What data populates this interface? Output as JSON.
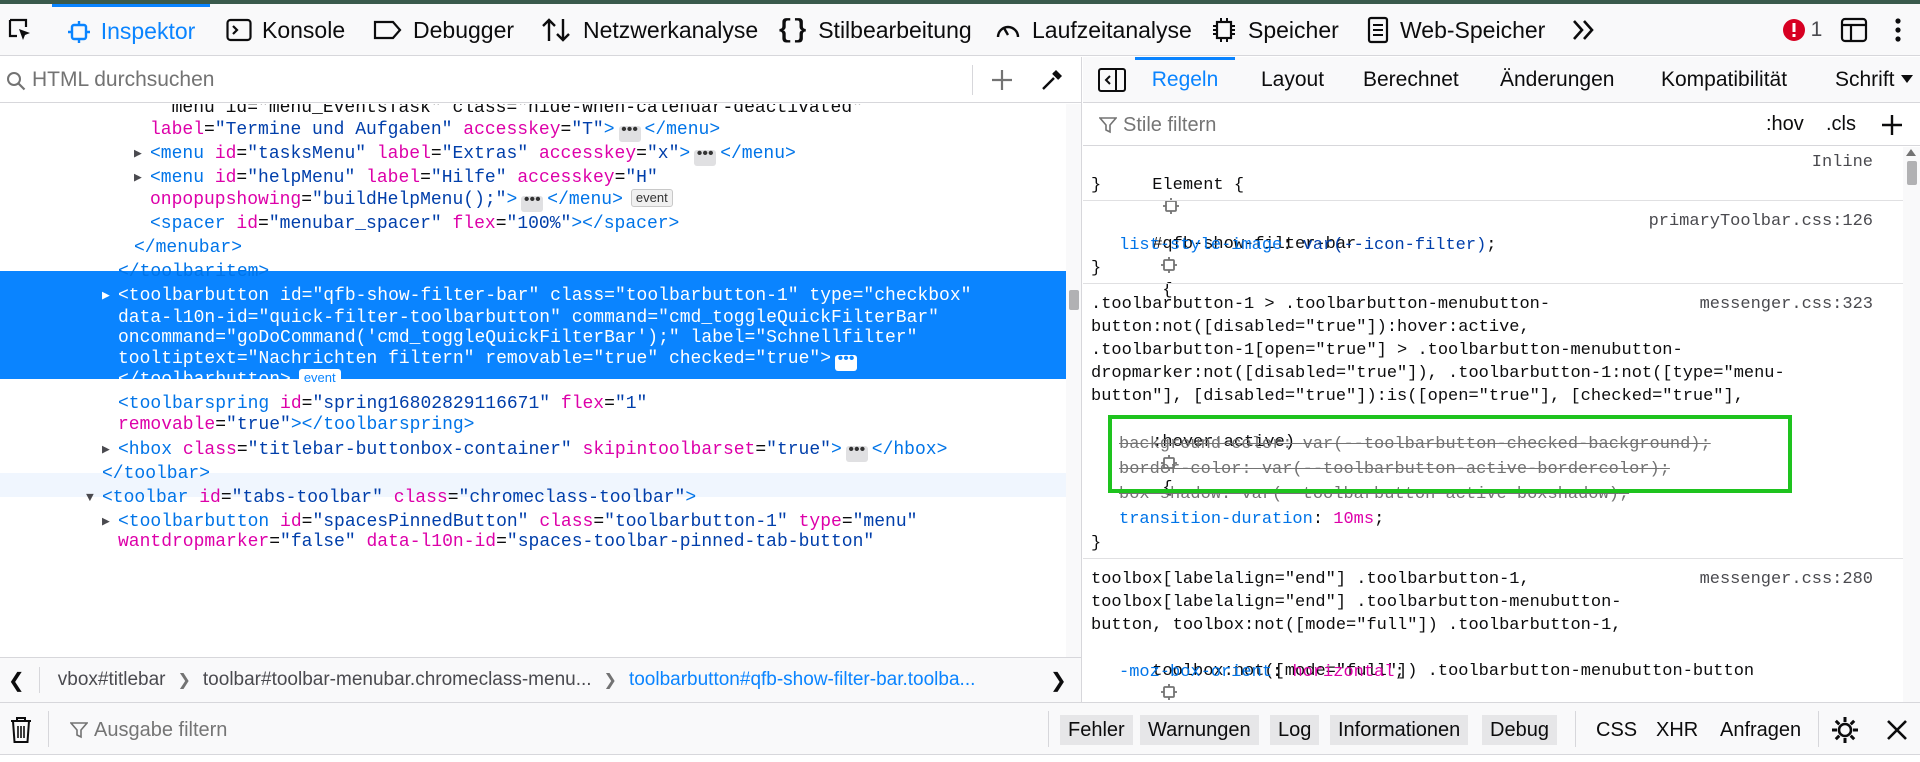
{
  "toolbar": {
    "tabs": [
      {
        "label": "Inspektor",
        "icon": "inspector-icon",
        "active": true
      },
      {
        "label": "Konsole",
        "icon": "console-icon"
      },
      {
        "label": "Debugger",
        "icon": "debugger-icon"
      },
      {
        "label": "Netzwerkanalyse",
        "icon": "network-icon"
      },
      {
        "label": "Stilbearbeitung",
        "icon": "style-editor-icon"
      },
      {
        "label": "Laufzeitanalyse",
        "icon": "performance-icon"
      },
      {
        "label": "Speicher",
        "icon": "memory-icon"
      },
      {
        "label": "Web-Speicher",
        "icon": "storage-icon"
      }
    ],
    "error_count": "1",
    "accent": "#0a84ff",
    "error_color": "#d70022"
  },
  "markup_search": {
    "placeholder": "HTML durchsuchen"
  },
  "markup": {
    "lines": [
      {
        "t": [
          [
            "tx",
            "  menu id=\"menu_EventsTask\" class=\"hide-when-calendar-deactivated\""
          ]
        ]
      },
      {
        "t": [
          [
            "an",
            "label"
          ],
          [
            "tx",
            "="
          ],
          [
            "av",
            "\"Termine und Aufgaben\""
          ],
          [
            "tx",
            " "
          ],
          [
            "an",
            "accesskey"
          ],
          [
            "tx",
            "="
          ],
          [
            "av",
            "\"T\""
          ],
          [
            "tag",
            ">"
          ],
          [
            "ell",
            "•••"
          ],
          [
            "tag",
            "</menu>"
          ]
        ]
      },
      {
        "t": [
          [
            "tag",
            "<menu "
          ],
          [
            "an",
            "id"
          ],
          [
            "tx",
            "="
          ],
          [
            "av",
            "\"tasksMenu\""
          ],
          [
            "tx",
            " "
          ],
          [
            "an",
            "label"
          ],
          [
            "tx",
            "="
          ],
          [
            "av",
            "\"Extras\""
          ],
          [
            "tx",
            " "
          ],
          [
            "an",
            "accesskey"
          ],
          [
            "tx",
            "="
          ],
          [
            "av",
            "\"x\""
          ],
          [
            "tag",
            ">"
          ],
          [
            "ell",
            "•••"
          ],
          [
            "tag",
            "</menu>"
          ]
        ]
      },
      {
        "t": [
          [
            "tag",
            "<menu "
          ],
          [
            "an",
            "id"
          ],
          [
            "tx",
            "="
          ],
          [
            "av",
            "\"helpMenu\""
          ],
          [
            "tx",
            " "
          ],
          [
            "an",
            "label"
          ],
          [
            "tx",
            "="
          ],
          [
            "av",
            "\"Hilfe\""
          ],
          [
            "tx",
            " "
          ],
          [
            "an",
            "accesskey"
          ],
          [
            "tx",
            "="
          ],
          [
            "av",
            "\"H\""
          ]
        ]
      },
      {
        "t": [
          [
            "an",
            "onpopupshowing"
          ],
          [
            "tx",
            "="
          ],
          [
            "av",
            "\"buildHelpMenu();\""
          ],
          [
            "tag",
            ">"
          ],
          [
            "ell",
            "•••"
          ],
          [
            "tag",
            "</menu>"
          ],
          [
            "badge",
            "event"
          ]
        ]
      },
      {
        "t": [
          [
            "tag",
            "<spacer "
          ],
          [
            "an",
            "id"
          ],
          [
            "tx",
            "="
          ],
          [
            "av",
            "\"menubar_spacer\""
          ],
          [
            "tx",
            " "
          ],
          [
            "an",
            "flex"
          ],
          [
            "tx",
            "="
          ],
          [
            "av",
            "\"100%\""
          ],
          [
            "tag",
            "></spacer>"
          ]
        ]
      },
      {
        "t": [
          [
            "tag",
            "</menubar>"
          ]
        ]
      },
      {
        "t": [
          [
            "tag",
            "</toolbaritem>"
          ]
        ]
      },
      {
        "t": [
          [
            "tag",
            "<toolbarbutton "
          ],
          [
            "an",
            "id"
          ],
          [
            "tx",
            "="
          ],
          [
            "av",
            "\"qfb-show-filter-bar\""
          ],
          [
            "tx",
            " "
          ],
          [
            "an",
            "class"
          ],
          [
            "tx",
            "="
          ],
          [
            "av",
            "\"toolbarbutton-1\""
          ],
          [
            "tx",
            " "
          ],
          [
            "an",
            "type"
          ],
          [
            "tx",
            "="
          ],
          [
            "av",
            "\"checkbox\""
          ]
        ]
      },
      {
        "t": [
          [
            "an",
            "data-l10n-id"
          ],
          [
            "tx",
            "="
          ],
          [
            "av",
            "\"quick-filter-toolbarbutton\""
          ],
          [
            "tx",
            " "
          ],
          [
            "an",
            "command"
          ],
          [
            "tx",
            "="
          ],
          [
            "av",
            "\"cmd_toggleQuickFilterBar\""
          ]
        ]
      },
      {
        "t": [
          [
            "an",
            "oncommand"
          ],
          [
            "tx",
            "="
          ],
          [
            "av",
            "\"goDoCommand('cmd_toggleQuickFilterBar');\""
          ],
          [
            "tx",
            " "
          ],
          [
            "an",
            "label"
          ],
          [
            "tx",
            "="
          ],
          [
            "av",
            "\"Schnellfilter\""
          ]
        ]
      },
      {
        "t": [
          [
            "an",
            "tooltiptext"
          ],
          [
            "tx",
            "="
          ],
          [
            "av",
            "\"Nachrichten filtern\""
          ],
          [
            "tx",
            " "
          ],
          [
            "an",
            "removable"
          ],
          [
            "tx",
            "="
          ],
          [
            "av",
            "\"true\""
          ],
          [
            "tx",
            " "
          ],
          [
            "an",
            "checked"
          ],
          [
            "tx",
            "="
          ],
          [
            "av",
            "\"true\""
          ],
          [
            "tag",
            ">"
          ],
          [
            "ell",
            "•••"
          ]
        ]
      },
      {
        "t": [
          [
            "tag",
            "</toolbarbutton>"
          ],
          [
            "badge",
            "event"
          ]
        ]
      },
      {
        "t": [
          [
            "tag",
            "<toolbarspring "
          ],
          [
            "an",
            "id"
          ],
          [
            "tx",
            "="
          ],
          [
            "av",
            "\"spring16802829116671\""
          ],
          [
            "tx",
            " "
          ],
          [
            "an",
            "flex"
          ],
          [
            "tx",
            "="
          ],
          [
            "av",
            "\"1\""
          ]
        ]
      },
      {
        "t": [
          [
            "an",
            "removable"
          ],
          [
            "tx",
            "="
          ],
          [
            "av",
            "\"true\""
          ],
          [
            "tag",
            "></toolbarspring>"
          ]
        ]
      },
      {
        "t": [
          [
            "tag",
            "<hbox "
          ],
          [
            "an",
            "class"
          ],
          [
            "tx",
            "="
          ],
          [
            "av",
            "\"titlebar-buttonbox-container\""
          ],
          [
            "tx",
            " "
          ],
          [
            "an",
            "skipintoolbarset"
          ],
          [
            "tx",
            "="
          ],
          [
            "av",
            "\"true\""
          ],
          [
            "tag",
            ">"
          ],
          [
            "ell",
            "•••"
          ],
          [
            "tag",
            "</hbox>"
          ]
        ]
      },
      {
        "t": [
          [
            "tag",
            "</toolbar>"
          ]
        ]
      },
      {
        "t": [
          [
            "tag",
            "<toolbar "
          ],
          [
            "an",
            "id"
          ],
          [
            "tx",
            "="
          ],
          [
            "av",
            "\"tabs-toolbar\""
          ],
          [
            "tx",
            " "
          ],
          [
            "an",
            "class"
          ],
          [
            "tx",
            "="
          ],
          [
            "av",
            "\"chromeclass-toolbar\""
          ],
          [
            "tag",
            ">"
          ]
        ]
      },
      {
        "t": [
          [
            "tag",
            "<toolbarbutton "
          ],
          [
            "an",
            "id"
          ],
          [
            "tx",
            "="
          ],
          [
            "av",
            "\"spacesPinnedButton\""
          ],
          [
            "tx",
            " "
          ],
          [
            "an",
            "class"
          ],
          [
            "tx",
            "="
          ],
          [
            "av",
            "\"toolbarbutton-1\""
          ],
          [
            "tx",
            " "
          ],
          [
            "an",
            "type"
          ],
          [
            "tx",
            "="
          ],
          [
            "av",
            "\"menu\""
          ]
        ]
      },
      {
        "t": [
          [
            "an",
            "wantdropmarker"
          ],
          [
            "tx",
            "="
          ],
          [
            "av",
            "\"false\""
          ],
          [
            "tx",
            " "
          ],
          [
            "an",
            "data-l10n-id"
          ],
          [
            "tx",
            "="
          ],
          [
            "av",
            "\"spaces-toolbar-pinned-tab-button\""
          ]
        ]
      }
    ]
  },
  "breadcrumbs": [
    {
      "label": "vbox#titlebar"
    },
    {
      "label": "toolbar#toolbar-menubar.chromeclass-menu..."
    },
    {
      "label": "toolbarbutton#qfb-show-filter-bar.toolba..."
    }
  ],
  "rules_panel": {
    "tabs": [
      "Regeln",
      "Layout",
      "Berechnet",
      "Änderungen",
      "Kompatibilität",
      "Schrift"
    ],
    "filter_placeholder": "Stile filtern",
    "hov": ":hov",
    "cls": ".cls",
    "element_selector": "Element {",
    "element_source": "Inline",
    "close_brace": "}",
    "rule1": {
      "selector": "#qfb-show-filter-bar",
      "source": "primaryToolbar.css:126",
      "decls": [
        {
          "prop": "list-style-image",
          "value": "var(--icon-filter)"
        }
      ]
    },
    "rule2": {
      "source": "messenger.css:323",
      "selector_lines": [
        ".toolbarbutton-1 > .toolbarbutton-menubutton-",
        "button:not([disabled=\"true\"]):hover:active,",
        ".toolbarbutton-1[open=\"true\"] > .toolbarbutton-menubutton-",
        "dropmarker:not([disabled=\"true\"]), .toolbarbutton-1:not([type=\"menu-",
        "button\"], [disabled=\"true\"]):is([open=\"true\"], [checked=\"true\"],",
        ":hover:active)"
      ],
      "decls": [
        {
          "prop": "background-color",
          "value": "var(--toolbarbutton-checked-background)",
          "struck": true
        },
        {
          "prop": "border-color",
          "value": "var(--toolbarbutton-active-bordercolor)",
          "struck": true
        },
        {
          "prop": "box-shadow",
          "value": "var(--toolbarbutton-active-boxshadow)",
          "struck": true
        },
        {
          "prop": "transition-duration",
          "value": "10ms"
        }
      ]
    },
    "rule3": {
      "source": "messenger.css:280",
      "selector_lines": [
        "toolbox[labelalign=\"end\"] .toolbarbutton-1,",
        "toolbox[labelalign=\"end\"] .toolbarbutton-menubutton-",
        "button, toolbox:not([mode=\"full\"]) .toolbarbutton-1,",
        "toolbox:not([mode=\"full\"]) .toolbarbutton-menubutton-button"
      ],
      "decls": [
        {
          "prop": "-moz-box-orient",
          "value": "horizontal"
        }
      ]
    },
    "highlight_color": "#1ec31e"
  },
  "console": {
    "filter_placeholder": "Ausgabe filtern",
    "buttons": [
      "Fehler",
      "Warnungen",
      "Log",
      "Informationen",
      "Debug"
    ],
    "plain": [
      "CSS",
      "XHR",
      "Anfragen"
    ]
  }
}
